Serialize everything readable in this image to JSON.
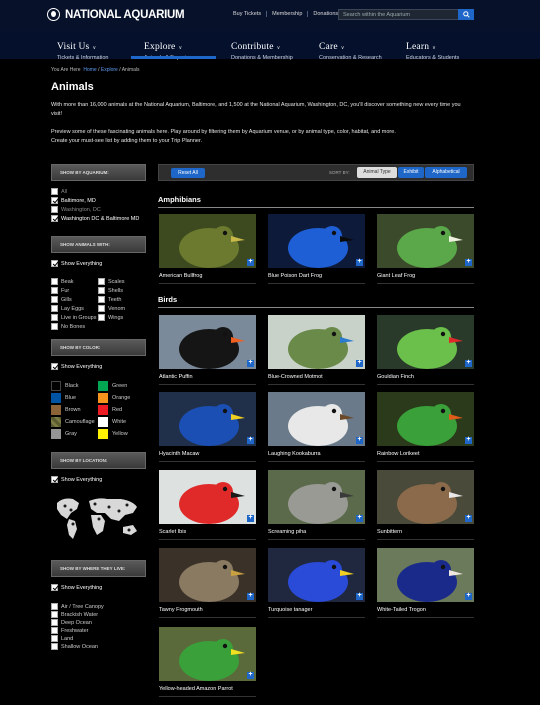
{
  "header": {
    "logo": "NATIONAL AQUARIUM",
    "links": [
      "Buy Tickets",
      "Membership",
      "Donations"
    ],
    "search_placeholder": "Search within the Aquarium"
  },
  "nav": [
    {
      "label": "Visit Us",
      "sub": "Tickets & Information"
    },
    {
      "label": "Explore",
      "sub": "Animals & Experiences"
    },
    {
      "label": "Contribute",
      "sub": "Donations & Membership"
    },
    {
      "label": "Care",
      "sub": "Conservation & Research"
    },
    {
      "label": "Learn",
      "sub": "Educators & Students"
    }
  ],
  "breadcrumb": {
    "prefix": "You Are Here",
    "items": [
      "Home",
      "Explore",
      "Animals"
    ],
    "sep": "/"
  },
  "page": {
    "title": "Animals",
    "intro1": "With more than 16,000 animals at the National Aquarium, Baltimore, and 1,500 at the National Aquarium, Washington, DC, you'll discover something new every time you visit!",
    "intro2": "Preview some of these fascinating animals here. Play around by filtering them by Aquarium venue, or by animal type, color, habitat, and more.",
    "intro3": "Create your must-see list by adding them to your Trip Planner."
  },
  "sidebar": {
    "aquarium_header": "SHOW BY AQUARIUM:",
    "aquarium_options": [
      {
        "label": "All",
        "checked": false,
        "dim": true
      },
      {
        "label": "Baltimore, MD",
        "checked": true,
        "dim": false
      },
      {
        "label": "Washington, DC",
        "checked": false,
        "dim": true
      },
      {
        "label": "Washington DC & Baltimore MD",
        "checked": true,
        "dim": false
      }
    ],
    "with_header": "SHOW ANIMALS WITH:",
    "show_everything": "Show Everything",
    "with_col1": [
      "Beak",
      "Fur",
      "Gills",
      "Lay Eggs",
      "Live in Groups",
      "No Bones"
    ],
    "with_col2": [
      "Scales",
      "Shells",
      "Teeth",
      "Venom",
      "Wings"
    ],
    "color_header": "SHOW BY COLOR:",
    "colors": [
      {
        "name": "Black",
        "hex": "#000000"
      },
      {
        "name": "Green",
        "hex": "#00a651"
      },
      {
        "name": "Blue",
        "hex": "#0054a6"
      },
      {
        "name": "Orange",
        "hex": "#f7941d"
      },
      {
        "name": "Brown",
        "hex": "#8c6239"
      },
      {
        "name": "Red",
        "hex": "#ed1c24"
      },
      {
        "name": "Camouflage",
        "hex": "#6b6b3a"
      },
      {
        "name": "White",
        "hex": "#ffffff"
      },
      {
        "name": "Gray",
        "hex": "#959595"
      },
      {
        "name": "Yellow",
        "hex": "#fff200"
      }
    ],
    "location_header": "SHOW BY LOCATION:",
    "habitat_header": "SHOW BY WHERE THEY LIVE:",
    "habitats": [
      "Air / Tree Canopy",
      "Brackish Water",
      "Deep Ocean",
      "Freshwater",
      "Land",
      "Shallow Ocean"
    ]
  },
  "controls": {
    "reset": "Reset All",
    "sort_label": "SORT BY:",
    "sort_options": [
      "Animal Type",
      "Exhibit",
      "Alphabetical"
    ],
    "sort_selected": "Animal Type"
  },
  "sections": [
    {
      "title": "Amphibians",
      "animals": [
        {
          "name": "American Bullfrog",
          "bg": "#3d4a1f",
          "fg": "#6b7a2e",
          "accent": "#c9b84a"
        },
        {
          "name": "Blue Poison Dart Frog",
          "bg": "#0d1a3a",
          "fg": "#1f5fd6",
          "accent": "#0a0a0a"
        },
        {
          "name": "Giant Leaf Frog",
          "bg": "#3a4a2a",
          "fg": "#5aa84a",
          "accent": "#f0f0e0"
        }
      ]
    },
    {
      "title": "Birds",
      "animals": [
        {
          "name": "Atlantic Puffin",
          "bg": "#7a8a9a",
          "fg": "#151515",
          "accent": "#f06020"
        },
        {
          "name": "Blue-Crowned Motmot",
          "bg": "#c8d2c8",
          "fg": "#6a8a4a",
          "accent": "#2a7ad0"
        },
        {
          "name": "Gouldian Finch",
          "bg": "#2a3a2a",
          "fg": "#6ac04a",
          "accent": "#e02a2a"
        },
        {
          "name": "Hyacinth Macaw",
          "bg": "#20304a",
          "fg": "#1c4fb4",
          "accent": "#f0d020"
        },
        {
          "name": "Laughing Kookaburra",
          "bg": "#6a7a8a",
          "fg": "#e8e8e8",
          "accent": "#6a4a2a"
        },
        {
          "name": "Rainbow Lorikeet",
          "bg": "#2a3a1a",
          "fg": "#3aa03a",
          "accent": "#e05a1a"
        },
        {
          "name": "Scarlet Ibis",
          "bg": "#dde2e0",
          "fg": "#e02a2a",
          "accent": "#1a1a1a"
        },
        {
          "name": "Screaming piha",
          "bg": "#5a6a4a",
          "fg": "#9a9a94",
          "accent": "#3a3a3a"
        },
        {
          "name": "Sunbittern",
          "bg": "#4a4a3a",
          "fg": "#8a6a4a",
          "accent": "#e8e8e8"
        },
        {
          "name": "Tawny Frogmouth",
          "bg": "#3a3228",
          "fg": "#8a7a62",
          "accent": "#c8a040"
        },
        {
          "name": "Turquoise tanager",
          "bg": "#202840",
          "fg": "#2a4ad8",
          "accent": "#f0d020"
        },
        {
          "name": "White-Tailed Trogon",
          "bg": "#6a7a5a",
          "fg": "#1a2a8a",
          "accent": "#f0e8e0"
        },
        {
          "name": "Yellow-headed Amazon Parrot",
          "bg": "#5a6a3a",
          "fg": "#3aa03a",
          "accent": "#f0e020"
        }
      ]
    }
  ]
}
